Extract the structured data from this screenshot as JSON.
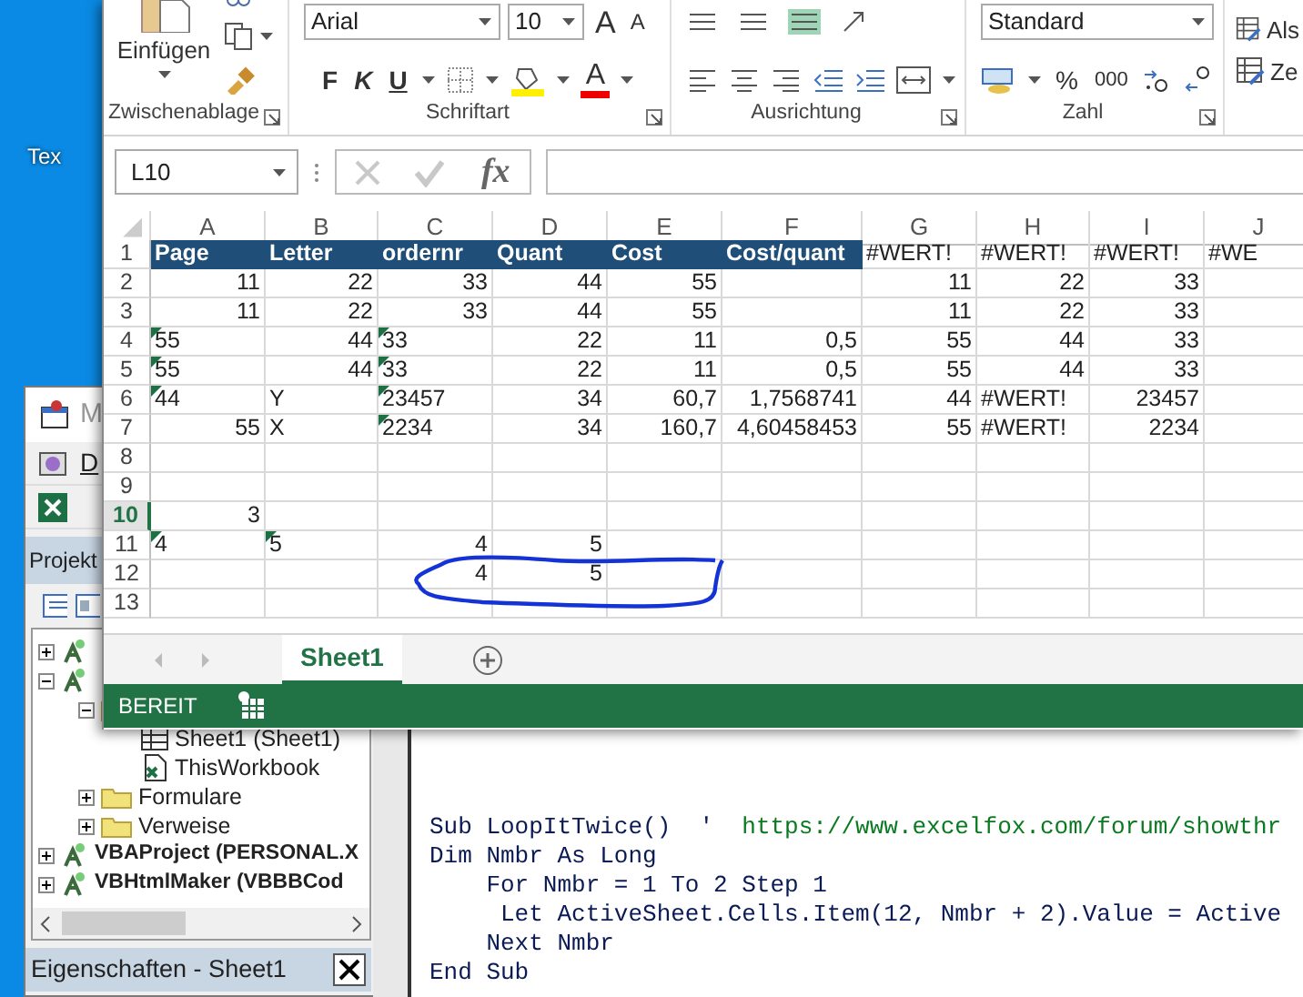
{
  "desktop": {
    "icon_label": "Tex"
  },
  "vba_editor": {
    "title": "M",
    "menu": "D",
    "project_header": "Projekt",
    "project_tree": [
      {
        "kind": "project",
        "expanded": false
      },
      {
        "kind": "project",
        "expanded": true,
        "children": [
          {
            "kind": "folder",
            "expanded": true,
            "children": [
              {
                "kind": "sheet",
                "label": "Sheet1 (Sheet1)"
              },
              {
                "kind": "workbook",
                "label": "ThisWorkbook"
              }
            ]
          },
          {
            "kind": "folder",
            "label": "Formulare",
            "expanded": false
          },
          {
            "kind": "folder",
            "label": "Verweise",
            "expanded": false
          }
        ]
      },
      {
        "kind": "project",
        "label": "VBAProject (PERSONAL.X",
        "expanded": false
      },
      {
        "kind": "project",
        "label": "VBHtmlMaker (VBBBCod",
        "expanded": false
      }
    ],
    "properties_header": "Eigenschaften - Sheet1",
    "code_lines": [
      {
        "parts": [
          {
            "text": "Sub LoopItTwice()  '  ",
            "kind": "code"
          },
          {
            "text": "https://www.excelfox.com/forum/showthr",
            "kind": "comment"
          }
        ]
      },
      {
        "parts": [
          {
            "text": "Dim Nmbr As Long",
            "kind": "code"
          }
        ]
      },
      {
        "parts": [
          {
            "text": "    For Nmbr = 1 To 2 Step 1",
            "kind": "code"
          }
        ]
      },
      {
        "parts": [
          {
            "text": "     Let ActiveSheet.Cells.Item(12, Nmbr + 2).Value = Active",
            "kind": "code"
          }
        ]
      },
      {
        "parts": [
          {
            "text": "    Next Nmbr",
            "kind": "code"
          }
        ]
      },
      {
        "parts": [
          {
            "text": "End Sub",
            "kind": "code"
          }
        ]
      }
    ]
  },
  "excel": {
    "ribbon": {
      "groups": [
        {
          "label": "Zwischenablage"
        },
        {
          "label": "Schriftart"
        },
        {
          "label": "Ausrichtung"
        },
        {
          "label": "Zahl"
        }
      ],
      "paste_label": "Einfügen",
      "font_name": "Arial",
      "font_size": "10",
      "grow": "A",
      "shrink": "A",
      "bold": "F",
      "italic": "K",
      "underline": "U",
      "font_color": "A",
      "number_format": "Standard",
      "percent": "%",
      "thousands": "000",
      "styles": [
        "Als",
        "Ze"
      ]
    },
    "name_box": "L10",
    "fx": "fx",
    "columns": [
      "A",
      "B",
      "C",
      "D",
      "E",
      "F",
      "G",
      "H",
      "I",
      "J"
    ],
    "rows": [
      {
        "number": "1",
        "selected": false,
        "cells": [
          {
            "text": "Page",
            "kind": "head",
            "flag": false
          },
          {
            "text": "Letter",
            "kind": "head",
            "flag": false
          },
          {
            "text": "ordernr",
            "kind": "head",
            "flag": false
          },
          {
            "text": "Quant",
            "kind": "head",
            "flag": false
          },
          {
            "text": "Cost",
            "kind": "head",
            "flag": false
          },
          {
            "text": "Cost/quant",
            "kind": "head",
            "flag": false
          },
          {
            "text": "#WERT!",
            "kind": "error",
            "flag": false
          },
          {
            "text": "#WERT!",
            "kind": "error",
            "flag": false
          },
          {
            "text": "#WERT!",
            "kind": "error",
            "flag": false
          },
          {
            "text": "#WE",
            "kind": "error",
            "flag": false
          }
        ]
      },
      {
        "number": "2",
        "selected": false,
        "cells": [
          {
            "text": "11",
            "kind": "num",
            "flag": false
          },
          {
            "text": "22",
            "kind": "num",
            "flag": false
          },
          {
            "text": "33",
            "kind": "num",
            "flag": false
          },
          {
            "text": "44",
            "kind": "num",
            "flag": false
          },
          {
            "text": "55",
            "kind": "num",
            "flag": false
          },
          null,
          {
            "text": "11",
            "kind": "num",
            "flag": false
          },
          {
            "text": "22",
            "kind": "num",
            "flag": false
          },
          {
            "text": "33",
            "kind": "num",
            "flag": false
          },
          null
        ]
      },
      {
        "number": "3",
        "selected": false,
        "cells": [
          {
            "text": "11",
            "kind": "num",
            "flag": false
          },
          {
            "text": "22",
            "kind": "num",
            "flag": false
          },
          {
            "text": "33",
            "kind": "num",
            "flag": false
          },
          {
            "text": "44",
            "kind": "num",
            "flag": false
          },
          {
            "text": "55",
            "kind": "num",
            "flag": false
          },
          null,
          {
            "text": "11",
            "kind": "num",
            "flag": false
          },
          {
            "text": "22",
            "kind": "num",
            "flag": false
          },
          {
            "text": "33",
            "kind": "num",
            "flag": false
          },
          null
        ]
      },
      {
        "number": "4",
        "selected": false,
        "cells": [
          {
            "text": "55",
            "kind": "text",
            "flag": true
          },
          {
            "text": "44",
            "kind": "num",
            "flag": false
          },
          {
            "text": "33",
            "kind": "text",
            "flag": true
          },
          {
            "text": "22",
            "kind": "num",
            "flag": false
          },
          {
            "text": "11",
            "kind": "num",
            "flag": false
          },
          {
            "text": "0,5",
            "kind": "num",
            "flag": false
          },
          {
            "text": "55",
            "kind": "num",
            "flag": false
          },
          {
            "text": "44",
            "kind": "num",
            "flag": false
          },
          {
            "text": "33",
            "kind": "num",
            "flag": false
          },
          null
        ]
      },
      {
        "number": "5",
        "selected": false,
        "cells": [
          {
            "text": "55",
            "kind": "text",
            "flag": true
          },
          {
            "text": "44",
            "kind": "num",
            "flag": false
          },
          {
            "text": "33",
            "kind": "text",
            "flag": true
          },
          {
            "text": "22",
            "kind": "num",
            "flag": false
          },
          {
            "text": "11",
            "kind": "num",
            "flag": false
          },
          {
            "text": "0,5",
            "kind": "num",
            "flag": false
          },
          {
            "text": "55",
            "kind": "num",
            "flag": false
          },
          {
            "text": "44",
            "kind": "num",
            "flag": false
          },
          {
            "text": "33",
            "kind": "num",
            "flag": false
          },
          null
        ]
      },
      {
        "number": "6",
        "selected": false,
        "cells": [
          {
            "text": "44",
            "kind": "text",
            "flag": true
          },
          {
            "text": "Y",
            "kind": "text",
            "flag": false
          },
          {
            "text": "23457",
            "kind": "text",
            "flag": true
          },
          {
            "text": "34",
            "kind": "num",
            "flag": false
          },
          {
            "text": "60,7",
            "kind": "num",
            "flag": false
          },
          {
            "text": "1,7568741",
            "kind": "num",
            "flag": false
          },
          {
            "text": "44",
            "kind": "num",
            "flag": false
          },
          {
            "text": "#WERT!",
            "kind": "error",
            "flag": false
          },
          {
            "text": "23457",
            "kind": "num",
            "flag": false
          },
          null
        ]
      },
      {
        "number": "7",
        "selected": false,
        "cells": [
          {
            "text": "55",
            "kind": "num",
            "flag": false
          },
          {
            "text": "X",
            "kind": "text",
            "flag": false
          },
          {
            "text": "2234",
            "kind": "text",
            "flag": true
          },
          {
            "text": "34",
            "kind": "num",
            "flag": false
          },
          {
            "text": "160,7",
            "kind": "num",
            "flag": false
          },
          {
            "text": "4,60458453",
            "kind": "num",
            "flag": false
          },
          {
            "text": "55",
            "kind": "num",
            "flag": false
          },
          {
            "text": "#WERT!",
            "kind": "error",
            "flag": false
          },
          {
            "text": "2234",
            "kind": "num",
            "flag": false
          },
          null
        ]
      },
      {
        "number": "8",
        "selected": false
      },
      {
        "number": "9",
        "selected": false
      },
      {
        "number": "10",
        "selected": true,
        "cells": [
          {
            "text": "3",
            "kind": "num",
            "flag": false
          }
        ]
      },
      {
        "number": "11",
        "selected": false,
        "cells": [
          {
            "text": "4",
            "kind": "text",
            "flag": true
          },
          {
            "text": "5",
            "kind": "text",
            "flag": true
          },
          {
            "text": "4",
            "kind": "num",
            "flag": false
          },
          {
            "text": "5",
            "kind": "num",
            "flag": false
          }
        ]
      },
      {
        "number": "12",
        "selected": false,
        "cells": [
          null,
          null,
          {
            "text": "4",
            "kind": "num",
            "flag": false
          },
          {
            "text": "5",
            "kind": "num",
            "flag": false
          }
        ]
      },
      {
        "number": "13",
        "selected": false
      }
    ],
    "sheet_tabs": [
      {
        "label": "Sheet1",
        "selected": true
      }
    ],
    "status": "BEREIT"
  }
}
